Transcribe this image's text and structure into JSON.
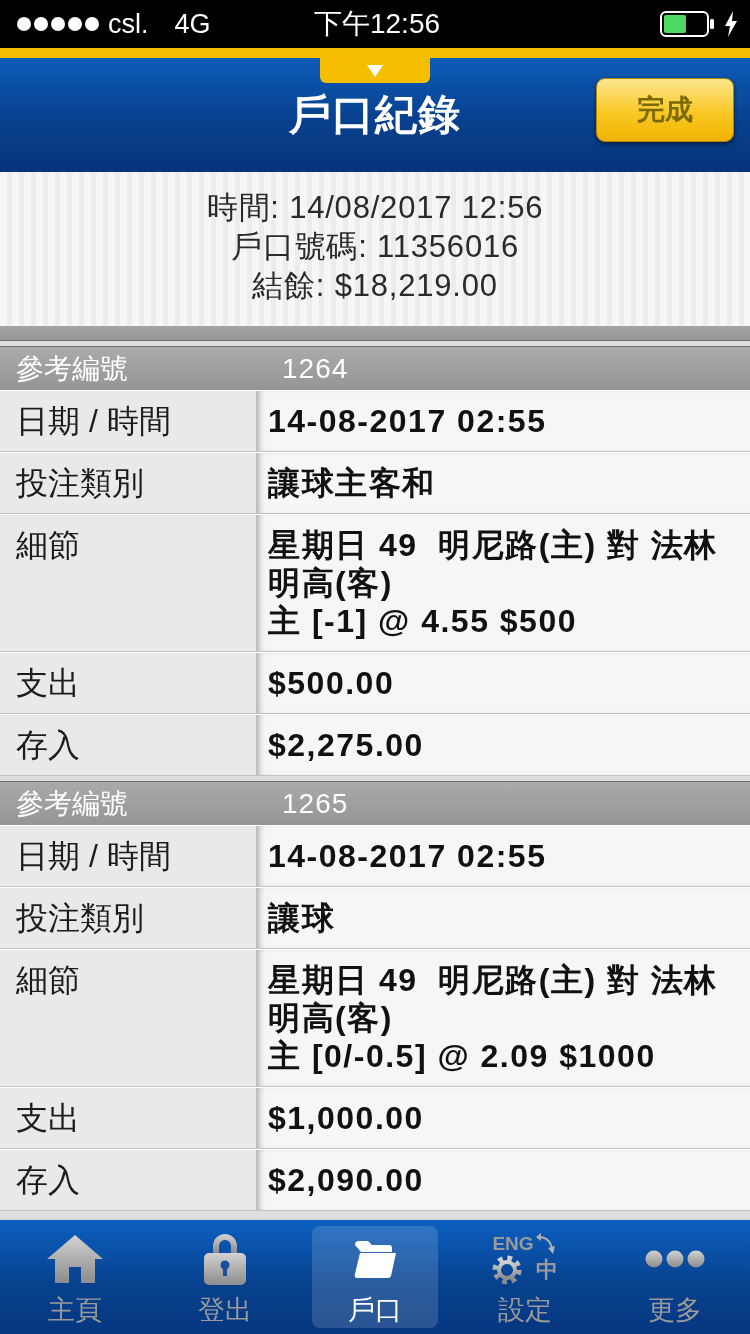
{
  "status_bar": {
    "carrier": "csl.",
    "network": "4G",
    "time": "下午12:56"
  },
  "header": {
    "title": "戶口紀錄",
    "done_button": "完成"
  },
  "summary": {
    "time": "時間: 14/08/2017 12:56",
    "account_number": "戶口號碼: 11356016",
    "balance": "結餘: $18,219.00"
  },
  "records": [
    {
      "ref_label": "參考編號",
      "ref": "1264",
      "fields": [
        {
          "label": "日期 / 時間",
          "value": "14-08-2017 02:55"
        },
        {
          "label": "投注類別",
          "value": "讓球主客和"
        },
        {
          "label": "細節",
          "value_lines": [
            "星期日 49  明尼路(主) 對 法林明高(客)",
            "主 [-1] @ 4.55 $500"
          ]
        },
        {
          "label": "支出",
          "value": "$500.00"
        },
        {
          "label": "存入",
          "value": "$2,275.00"
        }
      ]
    },
    {
      "ref_label": "參考編號",
      "ref": "1265",
      "fields": [
        {
          "label": "日期 / 時間",
          "value": "14-08-2017 02:55"
        },
        {
          "label": "投注類別",
          "value": "讓球"
        },
        {
          "label": "細節",
          "value_lines": [
            "星期日 49  明尼路(主) 對 法林明高(客)",
            "主 [0/-0.5] @ 2.09 $1000"
          ]
        },
        {
          "label": "支出",
          "value": "$1,000.00"
        },
        {
          "label": "存入",
          "value": "$2,090.00"
        }
      ]
    }
  ],
  "tabs": [
    {
      "label": "主頁",
      "kind": "home",
      "selected": false
    },
    {
      "label": "登出",
      "kind": "lock",
      "selected": false
    },
    {
      "label": "戶口",
      "kind": "folder",
      "selected": true
    },
    {
      "label": "設定",
      "kind": "language",
      "icon_texts": [
        "ENG",
        "中"
      ],
      "selected": false
    },
    {
      "label": "更多",
      "kind": "more",
      "selected": false
    }
  ]
}
